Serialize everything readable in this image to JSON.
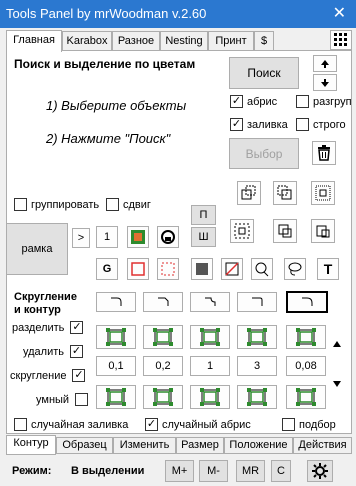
{
  "window": {
    "title": "Tools Panel by mrWoodman v.2.60",
    "close": "✕"
  },
  "top_tabs": [
    "Главная",
    "Karabox",
    "Разное",
    "Nesting",
    "Принт",
    "$"
  ],
  "heading": "Поиск и выделение по цветам",
  "steps": {
    "step1": "1) Выберите объекты",
    "step2": "2) Нажмите \"Поиск\""
  },
  "search_button": "Поиск",
  "select_button": "Выбор",
  "checks": {
    "abris": "абрис",
    "razgroup": "разгруп",
    "zalivka": "заливка",
    "strogo": "строго",
    "group": "группировать",
    "sdvig": "сдвиг"
  },
  "ramka_button": "рамка",
  "small_buttons": {
    "gt": ">",
    "one": "1",
    "p": "П",
    "sh": "Ш",
    "g": "G",
    "t": "T"
  },
  "round_heading": "Скругление\nи контур",
  "round_checks": {
    "delete_label": "разделить",
    "remove_label": "удалить",
    "round_label": "скругление",
    "smart_label": "умный"
  },
  "values": [
    "0,1",
    "0,2",
    "1",
    "3",
    "0,08"
  ],
  "bottom_checks": {
    "random_fill": "случайная заливка",
    "random_abris": "случайный абрис",
    "podbor": "подбор"
  },
  "bottom_tabs": [
    "Контур",
    "Образец",
    "Изменить",
    "Размер",
    "Положение",
    "Действия"
  ],
  "status": {
    "mode_label": "Режим:",
    "mode_value": "В выделении"
  },
  "status_buttons": [
    "M+",
    "M-",
    "MR",
    "C"
  ],
  "colors": {
    "titlebar": "#2b78d0",
    "green": "#2e8b2e",
    "red": "#e03030"
  }
}
